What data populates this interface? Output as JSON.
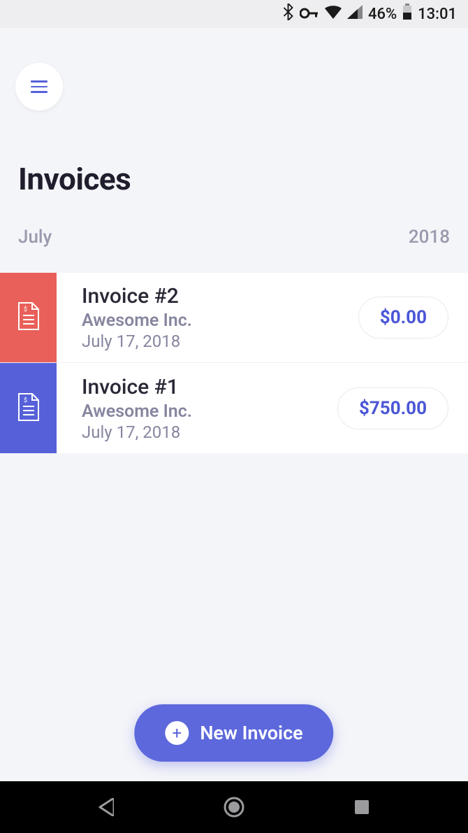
{
  "status_bar": {
    "battery_percent": "46%",
    "time": "13:01"
  },
  "page": {
    "title": "Invoices",
    "month": "July",
    "year": "2018"
  },
  "invoices": [
    {
      "title": "Invoice #2",
      "company": "Awesome Inc.",
      "date": "July 17, 2018",
      "amount": "$0.00",
      "strip_color": "red"
    },
    {
      "title": "Invoice #1",
      "company": "Awesome Inc.",
      "date": "July 17, 2018",
      "amount": "$750.00",
      "strip_color": "blue"
    }
  ],
  "fab": {
    "label": "New Invoice"
  }
}
